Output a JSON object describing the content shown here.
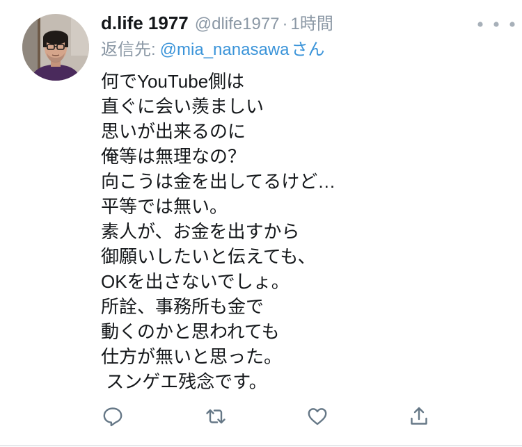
{
  "tweet": {
    "avatar_icon": "profile-photo",
    "display_name": "d.life 1977",
    "handle": "@dlife1977",
    "separator": "·",
    "time": "1時間",
    "more_icon": "more-icon",
    "reply_to_label": "返信先:",
    "reply_to_user": "@mia_nanasawa",
    "reply_to_suffix": "さん",
    "text_lines": [
      "何でYouTube側は",
      "直ぐに会い羨ましい",
      "思いが出来るのに",
      "俺等は無理なの？",
      "向こうは金を出してるけど…",
      "平等では無い。",
      "素人が、お金を出すから",
      "御願いしたいと伝えても、",
      "OKを出さないでしょ。",
      "所詮、事務所も金で",
      "動くのかと思われても",
      "仕方が無いと思った。",
      " スンゲエ残念です。"
    ]
  },
  "actions": [
    {
      "name": "reply",
      "icon": "reply-icon"
    },
    {
      "name": "retweet",
      "icon": "retweet-icon"
    },
    {
      "name": "like",
      "icon": "heart-icon"
    },
    {
      "name": "share",
      "icon": "share-icon"
    }
  ],
  "colors": {
    "text": "#14171a",
    "secondary": "#8b98a5",
    "link": "#3b94d9",
    "icon": "#657786",
    "divider": "#e6e8eb"
  }
}
